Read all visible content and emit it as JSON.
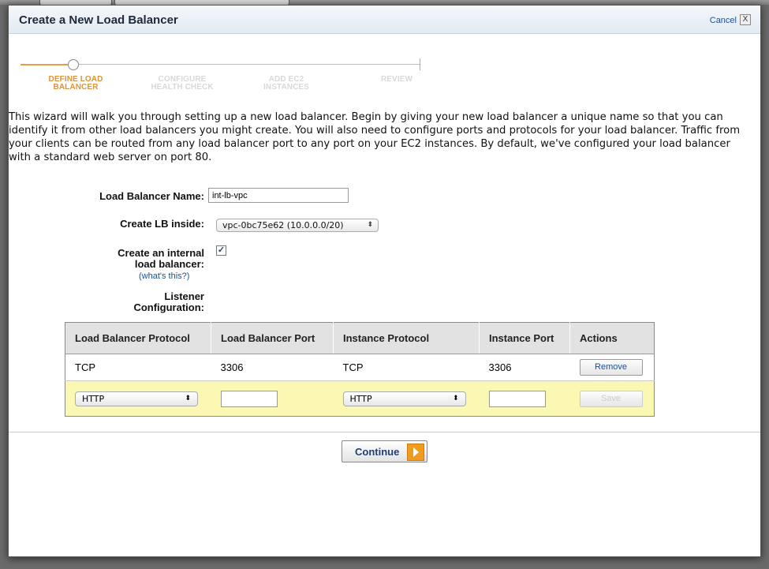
{
  "dialog": {
    "title": "Create a New Load Balancer",
    "cancel_label": "Cancel",
    "cancel_x": "X"
  },
  "wizard_steps": [
    {
      "line1": "DEFINE LOAD",
      "line2": "BALANCER",
      "active": true
    },
    {
      "line1": "CONFIGURE",
      "line2": "HEALTH CHECK",
      "active": false
    },
    {
      "line1": "ADD EC2",
      "line2": "INSTANCES",
      "active": false
    },
    {
      "line1": "REVIEW",
      "line2": "",
      "active": false
    }
  ],
  "intro_text": "This wizard will walk you through setting up a new load balancer. Begin by giving your new load balancer a unique name so that you can identify it from other load balancers you might create. You will also need to configure ports and protocols for your load balancer. Traffic from your clients can be routed from any load balancer port to any port on your EC2 instances. By default, we've configured your load balancer with a standard web server on port 80.",
  "form": {
    "name_label": "Load Balancer Name:",
    "name_value": "int-lb-vpc",
    "inside_label": "Create LB inside:",
    "inside_value": "vpc-0bc75e62 (10.0.0.0/20)",
    "internal_label_line1": "Create an internal",
    "internal_label_line2": "load balancer:",
    "internal_checked": true,
    "internal_check_mark": "✓",
    "whats_this": "(what's this?)",
    "listener_label_line1": "Listener",
    "listener_label_line2": "Configuration:"
  },
  "listener_table": {
    "headers": [
      "Load Balancer Protocol",
      "Load Balancer Port",
      "Instance Protocol",
      "Instance Port",
      "Actions"
    ],
    "rows": [
      {
        "lb_protocol": "TCP",
        "lb_port": "3306",
        "instance_protocol": "TCP",
        "instance_port": "3306",
        "action": "Remove"
      }
    ],
    "new_row": {
      "lb_protocol": "HTTP",
      "lb_port": "",
      "instance_protocol": "HTTP",
      "instance_port": "",
      "action": "Save"
    }
  },
  "footer": {
    "continue_label": "Continue"
  },
  "colors": {
    "active_step": "#d9953a",
    "new_row_bg": "#fbf8b3",
    "continue_arrow": "#f19c1f",
    "link": "#1b4f91"
  }
}
